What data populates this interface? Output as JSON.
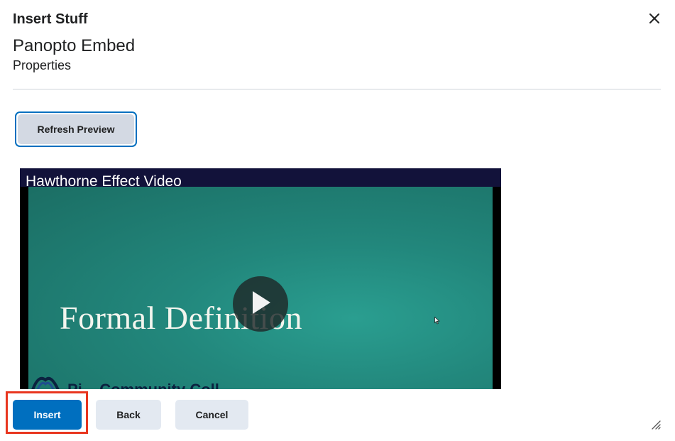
{
  "dialog": {
    "title": "Insert Stuff",
    "close_icon": "close-icon"
  },
  "section": {
    "title": "Panopto Embed",
    "subtitle": "Properties"
  },
  "refresh_button": {
    "label": "Refresh Preview"
  },
  "video": {
    "title": "Hawthorne Effect Video",
    "slide_text": "Formal Definition",
    "college_text": "Pi... Community Coll...",
    "play_icon": "play-icon",
    "colors": {
      "background": "#22877c",
      "titlebar": "#12123a"
    }
  },
  "footer": {
    "insert_label": "Insert",
    "back_label": "Back",
    "cancel_label": "Cancel"
  },
  "colors": {
    "primary": "#006fbf",
    "secondary_button": "#e3e9f1",
    "highlight": "#e8361f"
  }
}
